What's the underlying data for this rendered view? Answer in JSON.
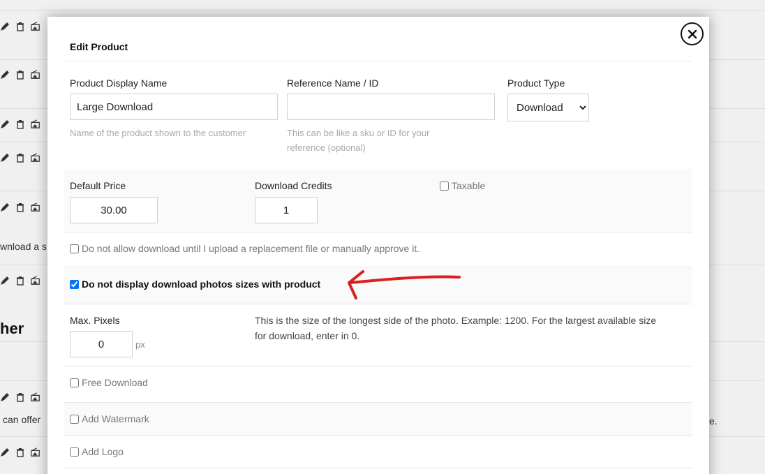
{
  "background": {
    "icons": [
      "pencil-icon",
      "trash-icon",
      "image-edit-icon"
    ],
    "snippets": {
      "download_text": "wnload a s",
      "heading": "her",
      "offer_text": "can offer",
      "right_text": "e."
    }
  },
  "modal": {
    "title": "Edit Product",
    "close_icon": "close-circle-icon",
    "display_name": {
      "label": "Product Display Name",
      "value": "Large Download",
      "help": "Name of the product shown to the customer"
    },
    "reference": {
      "label": "Reference Name / ID",
      "value": "",
      "help": "This can be like a sku or ID for your reference (optional)"
    },
    "product_type": {
      "label": "Product Type",
      "selected": "Download"
    },
    "default_price": {
      "label": "Default Price",
      "value": "30.00"
    },
    "download_credits": {
      "label": "Download Credits",
      "value": "1"
    },
    "taxable": {
      "label": "Taxable",
      "checked": false
    },
    "no_download_until_approve": {
      "label": "Do not allow download until I upload a replacement file or manually approve it.",
      "checked": false
    },
    "no_display_sizes": {
      "label": "Do not display download photos sizes with product",
      "checked": true
    },
    "max_pixels": {
      "label": "Max. Pixels",
      "value": "0",
      "unit": "px",
      "description": "This is the size of the longest side of the photo. Example: 1200. For the largest available size for download, enter in 0."
    },
    "free_download": {
      "label": "Free Download",
      "checked": false
    },
    "add_watermark": {
      "label": "Add Watermark",
      "checked": false
    },
    "add_logo": {
      "label": "Add Logo",
      "checked": false
    },
    "annotation_color": "#d92020"
  }
}
